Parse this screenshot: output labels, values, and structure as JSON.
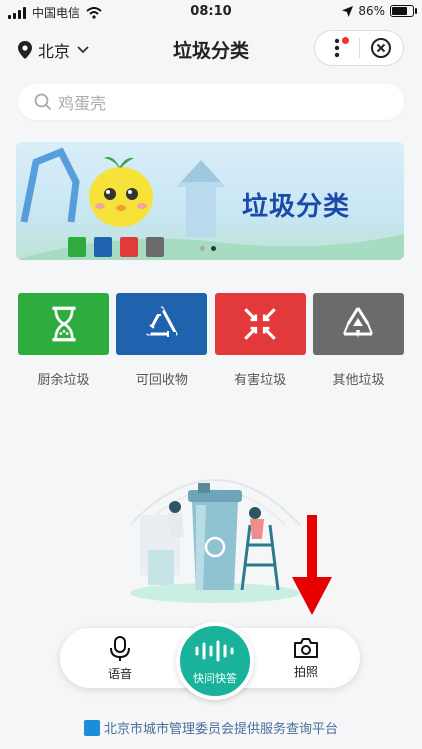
{
  "status_bar": {
    "carrier": "中国电信",
    "time": "08:10",
    "battery": "86%",
    "battery_level": 0.86
  },
  "nav": {
    "city": "北京",
    "title": "垃圾分类"
  },
  "search": {
    "placeholder": "鸡蛋壳"
  },
  "banner": {
    "title": "垃圾分类",
    "page_count": 2,
    "active_index": 1
  },
  "categories": [
    {
      "label": "厨余垃圾",
      "color": "#2fac3e",
      "icon": "hourglass-icon"
    },
    {
      "label": "可回收物",
      "color": "#1f62ad",
      "icon": "recycle-icon"
    },
    {
      "label": "有害垃圾",
      "color": "#e23a3a",
      "icon": "hazard-arrows-icon"
    },
    {
      "label": "其他垃圾",
      "color": "#6b6b6b",
      "icon": "other-recycle-icon"
    }
  ],
  "bottom_bar": {
    "voice_label": "语音",
    "center_label": "快问快答",
    "photo_label": "拍照",
    "accent": "#19b39b"
  },
  "footer": {
    "text": "北京市城市管理委员会提供服务查询平台"
  }
}
